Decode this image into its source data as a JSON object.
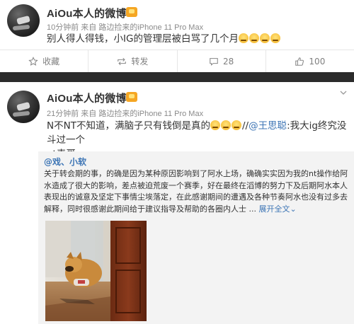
{
  "post1": {
    "username": "AiOu本人的微博",
    "meta": "10分钟前 来自 路边捡来的iPhone 11 Pro Max",
    "text": "别人得人得钱，小IG的管理层被白骂了几个月",
    "emoji_count": 4,
    "actions": {
      "favorite": "收藏",
      "repost": "转发",
      "comment": "28",
      "like": "100"
    }
  },
  "post2": {
    "username": "AiOu本人的微博",
    "meta": "21分钟前 来自 路边捡来的iPhone 11 Pro Max",
    "text_line1_a": "N不NT不知道，满脑子只有钱倒是真的",
    "text_line1_sep": "//",
    "mention": "@王思聪",
    "text_line1_b": ":我大ig终究没斗过一个",
    "text_line2": "nt表哥",
    "repost": {
      "user": "@戏、小软",
      "body": "关于转会期的事，的确是因为某种原因影响到了阿水上场，确确实实因为我的nt操作给阿水造成了很大的影响，差点被迫荒废一个赛季，好在最终在滔博的努力下及后期阿水本人表现出的诚意及坚定下事情尘埃落定，在此感谢期间的遭遇及各种节奏阿水也没有过多去解释，同时很感谢此期间给于建议指导及帮助的各圈内人士 ...",
      "expand": "展开全文",
      "expand_arrow": "⌄"
    }
  },
  "colors": {
    "link": "#3d75b5",
    "separator": "#2b2b2b",
    "repost_bg": "#f3f3f3"
  }
}
